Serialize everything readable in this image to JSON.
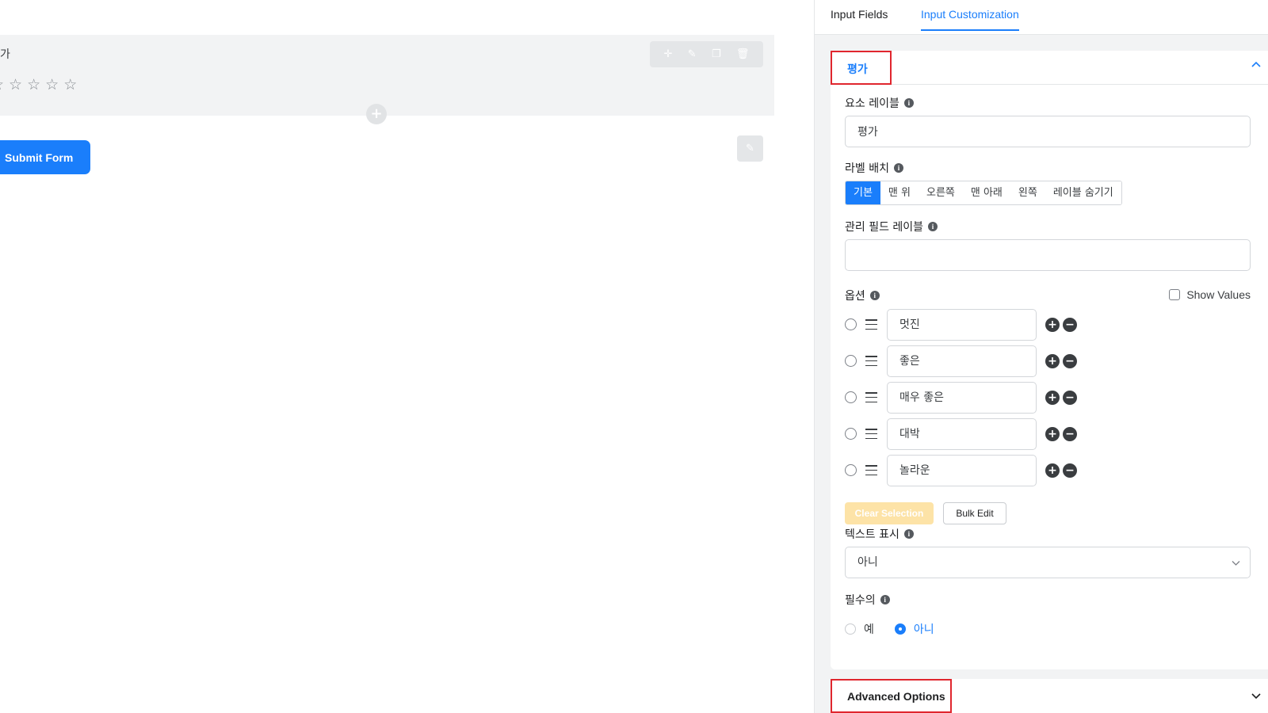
{
  "canvas": {
    "field_label": "가",
    "star_count": 5,
    "toolbar_icons": [
      "move-icon",
      "edit-icon",
      "copy-icon",
      "trash-icon"
    ],
    "submit_label": "Submit Form"
  },
  "tabs": [
    {
      "label": "Input Fields",
      "active": false
    },
    {
      "label": "Input Customization",
      "active": true
    }
  ],
  "panel": {
    "title": "평가",
    "element_label": {
      "label": "요소 레이블",
      "value": "평가"
    },
    "label_placement": {
      "label": "라벨 배치",
      "options": [
        "기본",
        "맨 위",
        "오른쪽",
        "맨 아래",
        "왼쪽",
        "레이블 숨기기"
      ],
      "selected": "기본"
    },
    "admin_label": {
      "label": "관리 필드 레이블",
      "value": ""
    },
    "options": {
      "label": "옵션",
      "show_values_label": "Show Values",
      "items": [
        "멋진",
        "좋은",
        "매우 좋은",
        "대박",
        "놀라운"
      ]
    },
    "clear_selection_label": "Clear Selection",
    "bulk_edit_label": "Bulk Edit",
    "show_text": {
      "label": "텍스트 표시",
      "value": "아니"
    },
    "required": {
      "label": "필수의",
      "options": [
        "예",
        "아니"
      ],
      "selected": "아니"
    },
    "advanced_options_label": "Advanced Options"
  },
  "colors": {
    "accent": "#1a7efb",
    "highlight_border": "#e0262e",
    "disabled_button": "#fde3a7"
  }
}
